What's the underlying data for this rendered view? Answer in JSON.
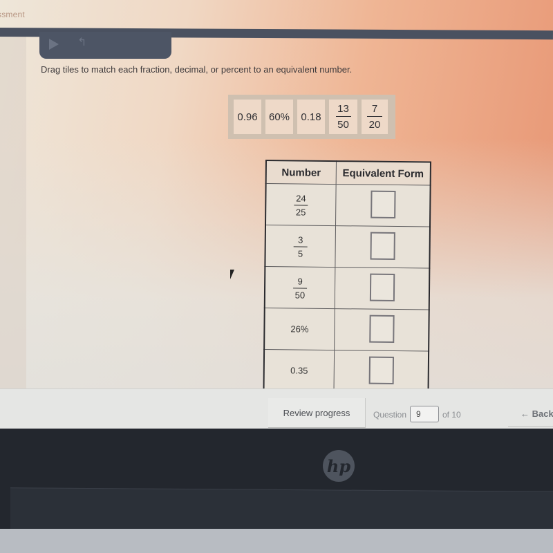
{
  "header": {
    "title_partial": "ssment"
  },
  "media_controls": {
    "play_icon": "play-icon",
    "undo_icon": "undo-icon"
  },
  "instructions": "Drag tiles to match each fraction, decimal, or percent to an equivalent number.",
  "tiles": [
    {
      "type": "text",
      "value": "0.96"
    },
    {
      "type": "text",
      "value": "60%"
    },
    {
      "type": "text",
      "value": "0.18"
    },
    {
      "type": "fraction",
      "numerator": "13",
      "denominator": "50"
    },
    {
      "type": "fraction",
      "numerator": "7",
      "denominator": "20"
    }
  ],
  "table": {
    "headers": [
      "Number",
      "Equivalent Form"
    ],
    "rows": [
      {
        "type": "fraction",
        "numerator": "24",
        "denominator": "25",
        "answer": ""
      },
      {
        "type": "fraction",
        "numerator": "3",
        "denominator": "5",
        "answer": ""
      },
      {
        "type": "fraction",
        "numerator": "9",
        "denominator": "50",
        "answer": ""
      },
      {
        "type": "text",
        "value": "26%",
        "answer": ""
      },
      {
        "type": "text",
        "value": "0.35",
        "answer": ""
      }
    ]
  },
  "footer": {
    "review_label": "Review progress",
    "question_label": "Question",
    "question_number": "9",
    "of_label": "of 10",
    "back_label": "← Back"
  },
  "device": {
    "logo": "hp"
  }
}
